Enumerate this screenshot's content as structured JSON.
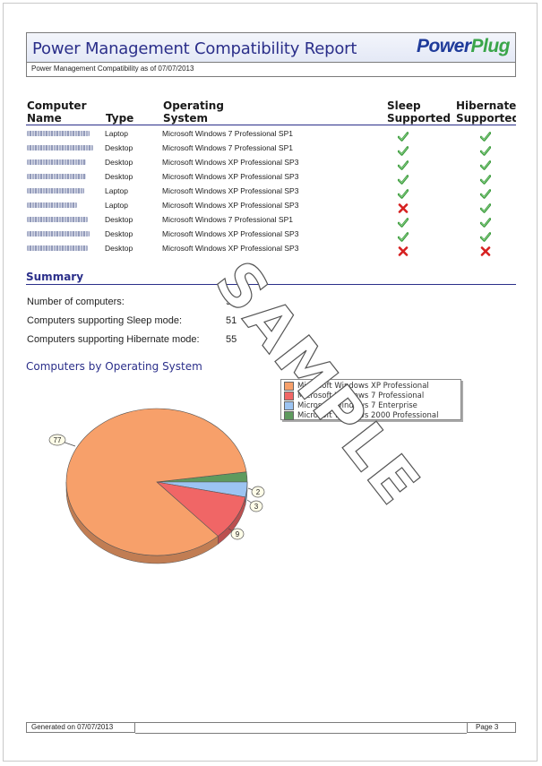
{
  "report": {
    "title": "Power Management Compatibility Report",
    "logo_part1": "Power",
    "logo_part2": "Plug",
    "subtitle": "Power Management Compatibility as of 07/07/2013"
  },
  "table": {
    "headers": {
      "computer_line1": "Computer",
      "computer_line2": "Name",
      "type": "Type",
      "os_line1": "Operating",
      "os_line2": "System",
      "sleep_line1": "Sleep",
      "sleep_line2": "Supported",
      "hibernate_line1": "Hibernate",
      "hibernate_line2": "Supported"
    },
    "rows": [
      {
        "type": "Laptop",
        "os": "Microsoft Windows 7 Professional  SP1",
        "sleep": "yes",
        "hibernate": "yes"
      },
      {
        "type": "Desktop",
        "os": "Microsoft Windows 7 Professional  SP1",
        "sleep": "yes",
        "hibernate": "yes"
      },
      {
        "type": "Desktop",
        "os": "Microsoft Windows XP Professional SP3",
        "sleep": "yes",
        "hibernate": "yes"
      },
      {
        "type": "Desktop",
        "os": "Microsoft Windows XP Professional SP3",
        "sleep": "yes",
        "hibernate": "yes"
      },
      {
        "type": "Laptop",
        "os": "Microsoft Windows XP Professional SP3",
        "sleep": "yes",
        "hibernate": "yes"
      },
      {
        "type": "Laptop",
        "os": "Microsoft Windows XP Professional SP3",
        "sleep": "no",
        "hibernate": "yes"
      },
      {
        "type": "Desktop",
        "os": "Microsoft Windows 7 Professional  SP1",
        "sleep": "yes",
        "hibernate": "yes"
      },
      {
        "type": "Desktop",
        "os": "Microsoft Windows XP Professional SP3",
        "sleep": "yes",
        "hibernate": "yes"
      },
      {
        "type": "Desktop",
        "os": "Microsoft Windows XP Professional SP3",
        "sleep": "no",
        "hibernate": "no"
      }
    ]
  },
  "summary": {
    "title": "Summary",
    "items": [
      {
        "label": "Number of computers:",
        "value": "91"
      },
      {
        "label": "Computers supporting Sleep mode:",
        "value": "51"
      },
      {
        "label": "Computers supporting Hibernate mode:",
        "value": "55"
      }
    ]
  },
  "chart_title": "Computers by Operating System",
  "chart_data": {
    "type": "pie",
    "title": "Computers by Operating System",
    "categories": [
      "Microsoft Windows XP Professional",
      "Microsoft Windows 7 Professional",
      "Microsoft Windows 7 Enterprise",
      "Microsoft Windows 2000 Professional"
    ],
    "values": [
      77,
      9,
      3,
      2
    ],
    "colors": [
      "#f7a06a",
      "#f06666",
      "#9cc4f2",
      "#5e9a5e"
    ],
    "legend_placement": "top-right"
  },
  "watermark": "SAMPLE",
  "footer": {
    "generated": "Generated on   07/07/2013",
    "page": "Page   3"
  },
  "icons": {
    "yes": "check-icon",
    "no": "cross-icon"
  }
}
